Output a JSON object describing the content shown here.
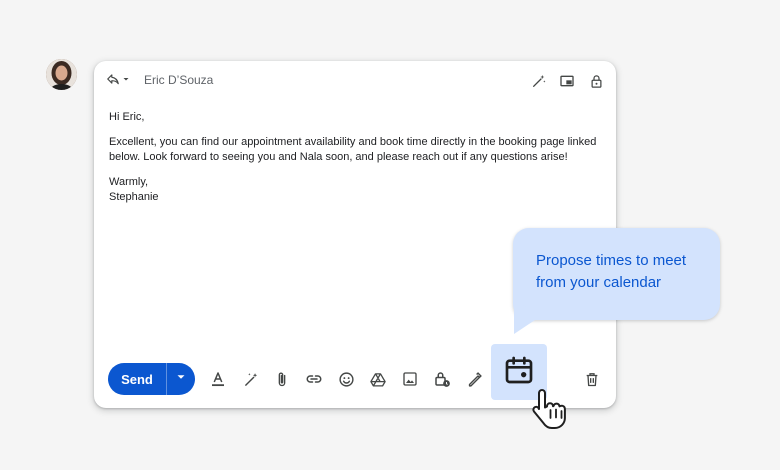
{
  "recipient": {
    "name": "Eric D’Souza"
  },
  "email_body": {
    "greeting": "Hi Eric,",
    "paragraph": "Excellent, you can find our appointment availability and book time directly in the booking page linked below. Look forward to seeing you and Nala soon, and please reach out if any questions arise!",
    "signoff": "Warmly,",
    "signature": "Stephanie"
  },
  "toolbar": {
    "send_label": "Send"
  },
  "tooltip": {
    "text": "Propose times to meet from your calendar"
  },
  "icons": {
    "header": [
      "reply-icon",
      "dropdown-arrow-icon",
      "magic-pen-icon",
      "pop-out-icon",
      "lock-icon"
    ],
    "toolbar": [
      "text-format-icon",
      "help-me-write-icon",
      "attach-icon",
      "link-icon",
      "emoji-icon",
      "drive-icon",
      "photo-icon",
      "confidential-mode-icon",
      "signature-icon",
      "calendar-icon",
      "trash-icon"
    ]
  },
  "colors": {
    "accent": "#0b57d0",
    "tooltip_bg": "#d3e3fd",
    "icon": "#444746",
    "background": "#f5f5f5"
  }
}
